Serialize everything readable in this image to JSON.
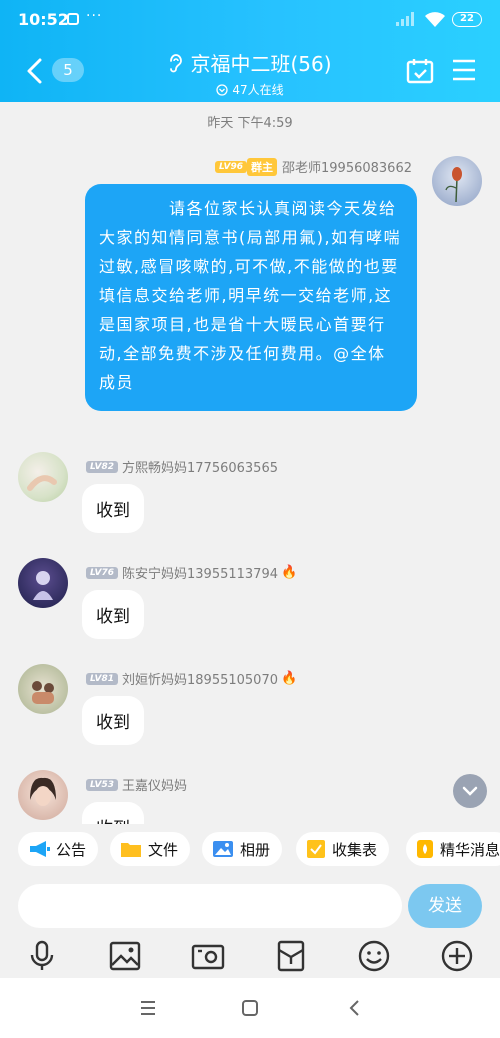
{
  "status_bar": {
    "time": "10:52",
    "more": "···",
    "battery": "22"
  },
  "header": {
    "unread_count": "5",
    "title": "京福中二班(56)",
    "online": "47人在线"
  },
  "chat": {
    "timestamp": "昨天 下午4:59",
    "pinned_message": {
      "level": "LV96",
      "role_badge": "群主",
      "sender": "邵老师19956083662",
      "text": "请各位家长认真阅读今天发给大家的知情同意书(局部用氟),如有哮喘过敏,感冒咳嗽的,可不做,不能做的也要填信息交给老师,明早统一交给老师,这是国家项目,也是省十大暖民心首要行动,全部免费不涉及任何费用。@全体成员"
    },
    "messages": [
      {
        "level": "LV82",
        "sender": "方熙畅妈妈17756063565",
        "text": "收到",
        "fire": ""
      },
      {
        "level": "LV76",
        "sender": "陈安宁妈妈13955113794",
        "text": "收到",
        "fire": "🔥"
      },
      {
        "level": "LV81",
        "sender": "刘姮忻妈妈18955105070",
        "text": "收到",
        "fire": "🔥"
      },
      {
        "level": "LV53",
        "sender": "王嘉仪妈妈",
        "text": "收到",
        "fire": ""
      }
    ]
  },
  "quick_bar": {
    "items": [
      {
        "label": "公告",
        "icon": "megaphone-icon"
      },
      {
        "label": "文件",
        "icon": "folder-icon"
      },
      {
        "label": "相册",
        "icon": "photo-icon"
      },
      {
        "label": "收集表",
        "icon": "form-icon"
      },
      {
        "label": "精华消息",
        "icon": "essence-icon"
      }
    ]
  },
  "composer": {
    "placeholder": "",
    "send_label": "发送"
  },
  "toolbar_icons": [
    "microphone-icon",
    "image-icon",
    "camera-icon",
    "red-packet-icon",
    "emoji-icon",
    "plus-icon"
  ],
  "colors": {
    "header": "#1ab8f8",
    "my_bubble": "#1da5f6",
    "send_button": "#7cc8f0",
    "owner_badge": "#ffc73a"
  }
}
